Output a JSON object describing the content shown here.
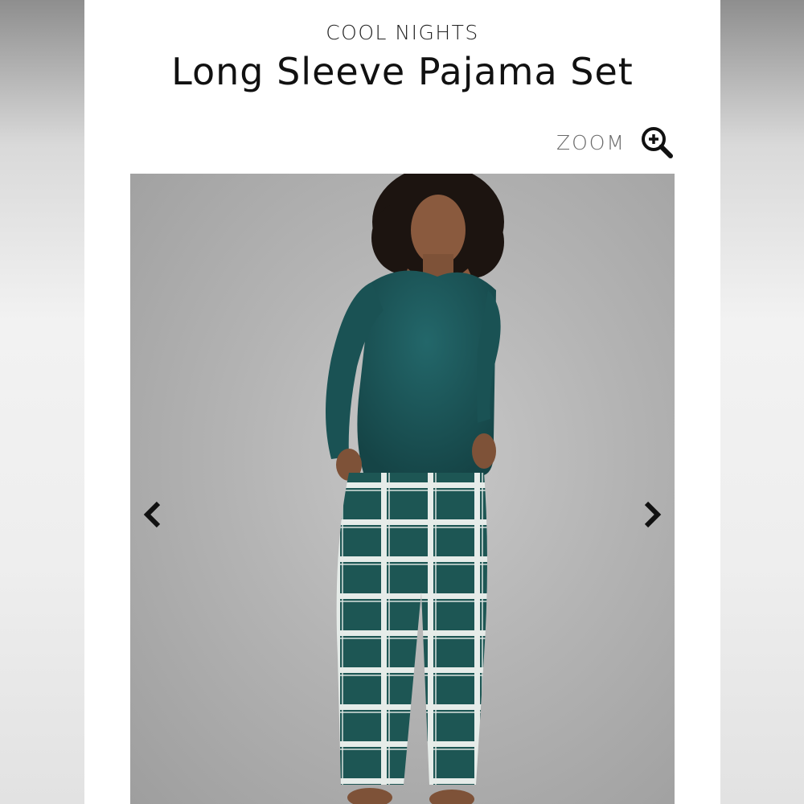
{
  "product": {
    "brand": "COOL NIGHTS",
    "title": "Long Sleeve Pajama Set"
  },
  "zoom": {
    "label": "ZOOM",
    "icon": "zoom-in-icon"
  },
  "gallery": {
    "prev_icon": "chevron-left-icon",
    "next_icon": "chevron-right-icon",
    "image_subject": "model wearing teal long sleeve top and plaid pajama pants"
  },
  "colors": {
    "top": "#1e5a5a",
    "pants": "#1d5654",
    "plaid_line": "#e6ece9",
    "background": "#b4b4b4"
  }
}
